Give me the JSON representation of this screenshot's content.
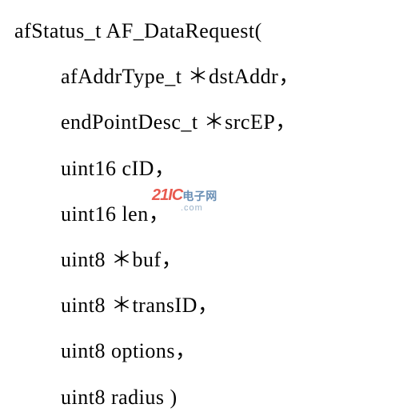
{
  "code": {
    "line1": "afStatus_t AF_DataRequest(",
    "params": [
      "afAddrType_t ＊dstAddr，",
      "endPointDesc_t ＊srcEP，",
      "uint16 cID，",
      "uint16 len，",
      "uint8 ＊buf，",
      "uint8 ＊transID，",
      "uint8 options，",
      "uint8 radius )"
    ]
  },
  "watermark": {
    "red": "21IC",
    "blue": "电子网",
    "url": ".com"
  }
}
